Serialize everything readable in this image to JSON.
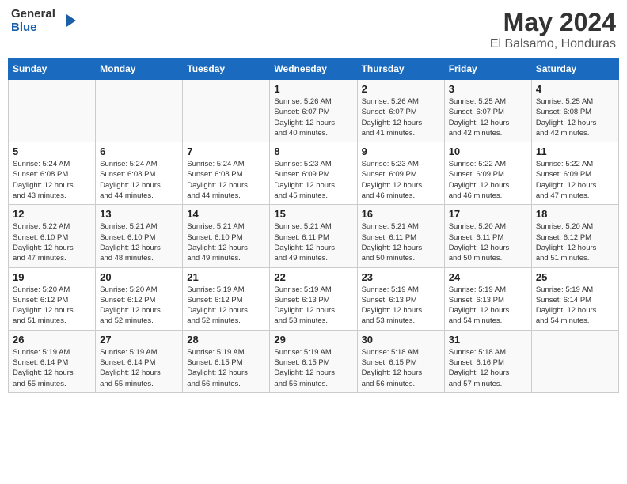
{
  "header": {
    "logo_line1": "General",
    "logo_line2": "Blue",
    "month": "May 2024",
    "location": "El Balsamo, Honduras"
  },
  "days_of_week": [
    "Sunday",
    "Monday",
    "Tuesday",
    "Wednesday",
    "Thursday",
    "Friday",
    "Saturday"
  ],
  "weeks": [
    [
      {
        "num": "",
        "info": ""
      },
      {
        "num": "",
        "info": ""
      },
      {
        "num": "",
        "info": ""
      },
      {
        "num": "1",
        "info": "Sunrise: 5:26 AM\nSunset: 6:07 PM\nDaylight: 12 hours\nand 40 minutes."
      },
      {
        "num": "2",
        "info": "Sunrise: 5:26 AM\nSunset: 6:07 PM\nDaylight: 12 hours\nand 41 minutes."
      },
      {
        "num": "3",
        "info": "Sunrise: 5:25 AM\nSunset: 6:07 PM\nDaylight: 12 hours\nand 42 minutes."
      },
      {
        "num": "4",
        "info": "Sunrise: 5:25 AM\nSunset: 6:08 PM\nDaylight: 12 hours\nand 42 minutes."
      }
    ],
    [
      {
        "num": "5",
        "info": "Sunrise: 5:24 AM\nSunset: 6:08 PM\nDaylight: 12 hours\nand 43 minutes."
      },
      {
        "num": "6",
        "info": "Sunrise: 5:24 AM\nSunset: 6:08 PM\nDaylight: 12 hours\nand 44 minutes."
      },
      {
        "num": "7",
        "info": "Sunrise: 5:24 AM\nSunset: 6:08 PM\nDaylight: 12 hours\nand 44 minutes."
      },
      {
        "num": "8",
        "info": "Sunrise: 5:23 AM\nSunset: 6:09 PM\nDaylight: 12 hours\nand 45 minutes."
      },
      {
        "num": "9",
        "info": "Sunrise: 5:23 AM\nSunset: 6:09 PM\nDaylight: 12 hours\nand 46 minutes."
      },
      {
        "num": "10",
        "info": "Sunrise: 5:22 AM\nSunset: 6:09 PM\nDaylight: 12 hours\nand 46 minutes."
      },
      {
        "num": "11",
        "info": "Sunrise: 5:22 AM\nSunset: 6:09 PM\nDaylight: 12 hours\nand 47 minutes."
      }
    ],
    [
      {
        "num": "12",
        "info": "Sunrise: 5:22 AM\nSunset: 6:10 PM\nDaylight: 12 hours\nand 47 minutes."
      },
      {
        "num": "13",
        "info": "Sunrise: 5:21 AM\nSunset: 6:10 PM\nDaylight: 12 hours\nand 48 minutes."
      },
      {
        "num": "14",
        "info": "Sunrise: 5:21 AM\nSunset: 6:10 PM\nDaylight: 12 hours\nand 49 minutes."
      },
      {
        "num": "15",
        "info": "Sunrise: 5:21 AM\nSunset: 6:11 PM\nDaylight: 12 hours\nand 49 minutes."
      },
      {
        "num": "16",
        "info": "Sunrise: 5:21 AM\nSunset: 6:11 PM\nDaylight: 12 hours\nand 50 minutes."
      },
      {
        "num": "17",
        "info": "Sunrise: 5:20 AM\nSunset: 6:11 PM\nDaylight: 12 hours\nand 50 minutes."
      },
      {
        "num": "18",
        "info": "Sunrise: 5:20 AM\nSunset: 6:12 PM\nDaylight: 12 hours\nand 51 minutes."
      }
    ],
    [
      {
        "num": "19",
        "info": "Sunrise: 5:20 AM\nSunset: 6:12 PM\nDaylight: 12 hours\nand 51 minutes."
      },
      {
        "num": "20",
        "info": "Sunrise: 5:20 AM\nSunset: 6:12 PM\nDaylight: 12 hours\nand 52 minutes."
      },
      {
        "num": "21",
        "info": "Sunrise: 5:19 AM\nSunset: 6:12 PM\nDaylight: 12 hours\nand 52 minutes."
      },
      {
        "num": "22",
        "info": "Sunrise: 5:19 AM\nSunset: 6:13 PM\nDaylight: 12 hours\nand 53 minutes."
      },
      {
        "num": "23",
        "info": "Sunrise: 5:19 AM\nSunset: 6:13 PM\nDaylight: 12 hours\nand 53 minutes."
      },
      {
        "num": "24",
        "info": "Sunrise: 5:19 AM\nSunset: 6:13 PM\nDaylight: 12 hours\nand 54 minutes."
      },
      {
        "num": "25",
        "info": "Sunrise: 5:19 AM\nSunset: 6:14 PM\nDaylight: 12 hours\nand 54 minutes."
      }
    ],
    [
      {
        "num": "26",
        "info": "Sunrise: 5:19 AM\nSunset: 6:14 PM\nDaylight: 12 hours\nand 55 minutes."
      },
      {
        "num": "27",
        "info": "Sunrise: 5:19 AM\nSunset: 6:14 PM\nDaylight: 12 hours\nand 55 minutes."
      },
      {
        "num": "28",
        "info": "Sunrise: 5:19 AM\nSunset: 6:15 PM\nDaylight: 12 hours\nand 56 minutes."
      },
      {
        "num": "29",
        "info": "Sunrise: 5:19 AM\nSunset: 6:15 PM\nDaylight: 12 hours\nand 56 minutes."
      },
      {
        "num": "30",
        "info": "Sunrise: 5:18 AM\nSunset: 6:15 PM\nDaylight: 12 hours\nand 56 minutes."
      },
      {
        "num": "31",
        "info": "Sunrise: 5:18 AM\nSunset: 6:16 PM\nDaylight: 12 hours\nand 57 minutes."
      },
      {
        "num": "",
        "info": ""
      }
    ]
  ]
}
